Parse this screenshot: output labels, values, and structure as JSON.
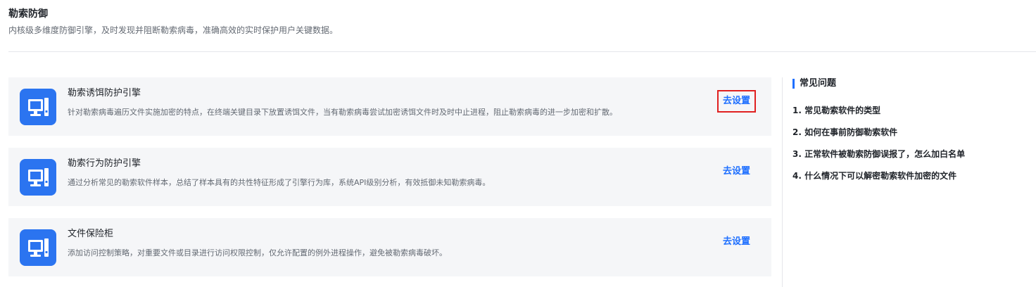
{
  "header": {
    "title": "勒索防御",
    "subtitle": "内核级多维度防御引擎，及时发现并阻断勒索病毒，准确高效的实时保护用户关键数据。"
  },
  "cards": [
    {
      "icon": "monitor-icon",
      "title": "勒索诱饵防护引擎",
      "description": "针对勒索病毒遍历文件实施加密的特点，在终端关键目录下放置诱饵文件，当有勒索病毒尝试加密诱饵文件时及时中止进程，阻止勒索病毒的进一步加密和扩散。",
      "action": "去设置",
      "highlighted": true
    },
    {
      "icon": "monitor-icon",
      "title": "勒索行为防护引擎",
      "description": "通过分析常见的勒索软件样本，总结了样本具有的共性特征形成了引擎行为库，系统API级别分析，有效抵御未知勒索病毒。",
      "action": "去设置",
      "highlighted": false
    },
    {
      "icon": "monitor-icon",
      "title": "文件保险柜",
      "description": "添加访问控制策略，对重要文件或目录进行访问权限控制，仅允许配置的例外进程操作，避免被勒索病毒破坏。",
      "action": "去设置",
      "highlighted": false
    }
  ],
  "faq": {
    "heading": "常见问题",
    "items": [
      "1. 常见勒索软件的类型",
      "2. 如何在事前防御勒索软件",
      "3. 正常软件被勒索防御误报了，怎么加白名单",
      "4. 什么情况下可以解密勒索软件加密的文件"
    ]
  },
  "colors": {
    "accent": "#1e6fff",
    "icon_bg": "#2b74f0",
    "card_bg": "#f5f6f8",
    "highlight_border": "#e02020"
  }
}
